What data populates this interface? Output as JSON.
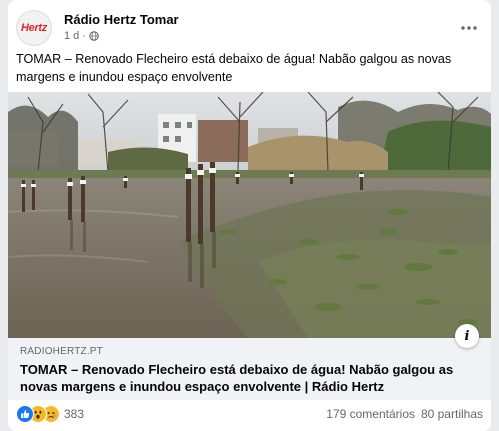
{
  "post": {
    "page_name": "Rádio Hertz Tomar",
    "avatar_text": "Hertz",
    "time": "1 d",
    "separator": "·",
    "text": "TOMAR – Renovado Flecheiro está debaixo de água! Nabão galgou as novas margens e inundou espaço envolvente"
  },
  "link": {
    "domain": "RADIOHERTZ.PT",
    "title": "TOMAR – Renovado Flecheiro está debaixo de água! Nabão galgou as novas margens e inundou espaço envolvente | Rádio Hertz"
  },
  "reactions": {
    "count": "383",
    "types": [
      "like",
      "wow",
      "sad"
    ]
  },
  "engagement": {
    "comments": "179 comentários",
    "shares": "80 partilhas"
  },
  "colors": {
    "brand_red": "#e3262e",
    "like_blue": "#1877f2",
    "emoji_yellow": "#f7b928"
  },
  "icons": {
    "more": "more-options-icon",
    "privacy": "globe-icon",
    "info": "info-icon"
  }
}
